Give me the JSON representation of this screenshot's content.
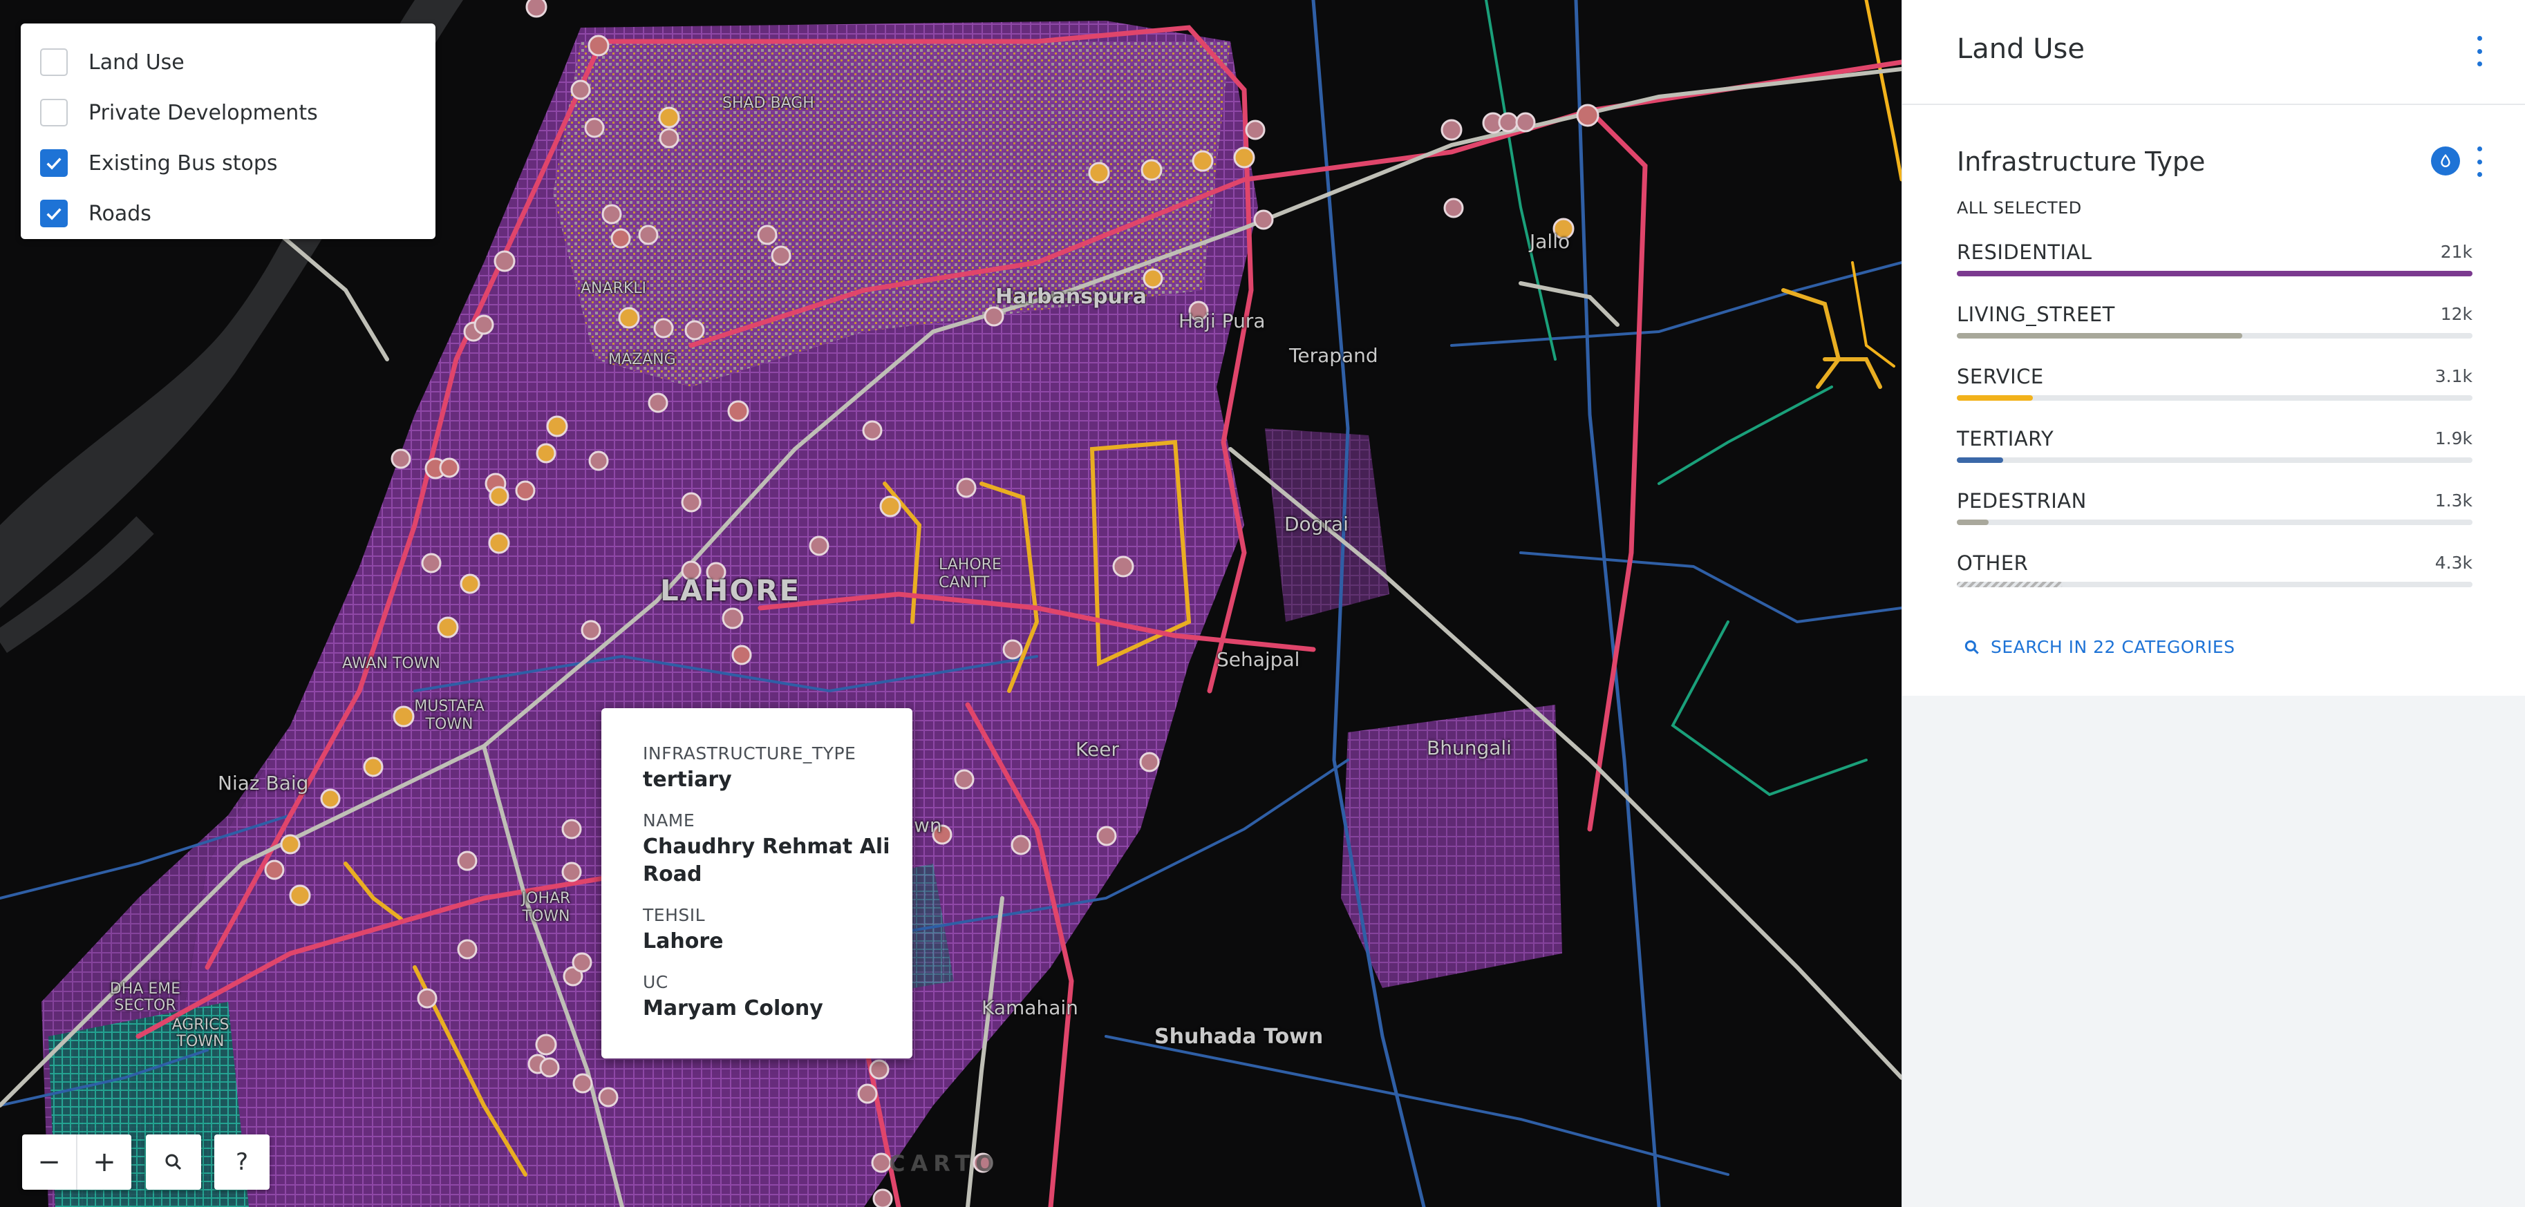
{
  "map": {
    "places": {
      "shad_bagh": "SHAD BAGH",
      "anarkali": "ANARKLI",
      "mazang": "MAZANG",
      "harbanspura": "Harbanspura",
      "haji_pura": "Haji Pura",
      "terapand": "Terapand",
      "jallo": "Jallo",
      "dograi": "Dograi",
      "lahore_cantt": "LAHORE CANTT",
      "lahore": "LAHORE",
      "awan_town": "AWAN TOWN",
      "mustafa_town": "MUSTAFA TOWN",
      "niaz_baig": "Niaz Baig",
      "sehajpal": "Sehajpal",
      "keer": "Keer",
      "bhungali": "Bhungali",
      "johar_town": "JOHAR TOWN",
      "dha_eme": "DHA EME SECTOR",
      "agrics_town": "AGRICS TOWN",
      "kamahain": "Kamahain",
      "shuhada_town": "Shuhada Town",
      "town_fragment": "wn"
    },
    "carto_logo": "CARTO"
  },
  "layers": {
    "items": [
      {
        "label": "Land Use",
        "checked": false
      },
      {
        "label": "Private Developments",
        "checked": false
      },
      {
        "label": "Existing Bus stops",
        "checked": true
      },
      {
        "label": "Roads",
        "checked": true
      }
    ]
  },
  "popup": {
    "infra_key": "INFRASTRUCTURE_TYPE",
    "infra_val": "tertiary",
    "name_key": "NAME",
    "name_val": "Chaudhry Rehmat Ali Road",
    "tehsil_key": "TEHSIL",
    "tehsil_val": "Lahore",
    "uc_key": "UC",
    "uc_val": "Maryam Colony"
  },
  "controls": {
    "zoom_out": "−",
    "zoom_in": "+",
    "help": "?"
  },
  "sidebar": {
    "title": "Land Use",
    "widget": {
      "title": "Infrastructure Type",
      "selection": "ALL SELECTED",
      "categories": [
        {
          "name": "RESIDENTIAL",
          "value": "21k",
          "fraction": 1.0,
          "color": "#7b3a8f"
        },
        {
          "name": "LIVING_STREET",
          "value": "12k",
          "fraction": 0.553,
          "color": "#a8a89a"
        },
        {
          "name": "SERVICE",
          "value": "3.1k",
          "fraction": 0.148,
          "color": "#f2b21b"
        },
        {
          "name": "TERTIARY",
          "value": "1.9k",
          "fraction": 0.09,
          "color": "#3b68a8"
        },
        {
          "name": "PEDESTRIAN",
          "value": "1.3k",
          "fraction": 0.062,
          "color": "#a9a89c"
        },
        {
          "name": "OTHER",
          "value": "4.3k",
          "fraction": 0.205,
          "color": "#b3b3b3"
        }
      ],
      "search_label": "SEARCH IN 22 CATEGORIES"
    }
  },
  "colors": {
    "accent": "#1e73d6",
    "map_background": "#0b0b0c",
    "residential": "#7b3a8f",
    "primary_road": "#e0456b",
    "bus_stop": "#c48a93"
  }
}
